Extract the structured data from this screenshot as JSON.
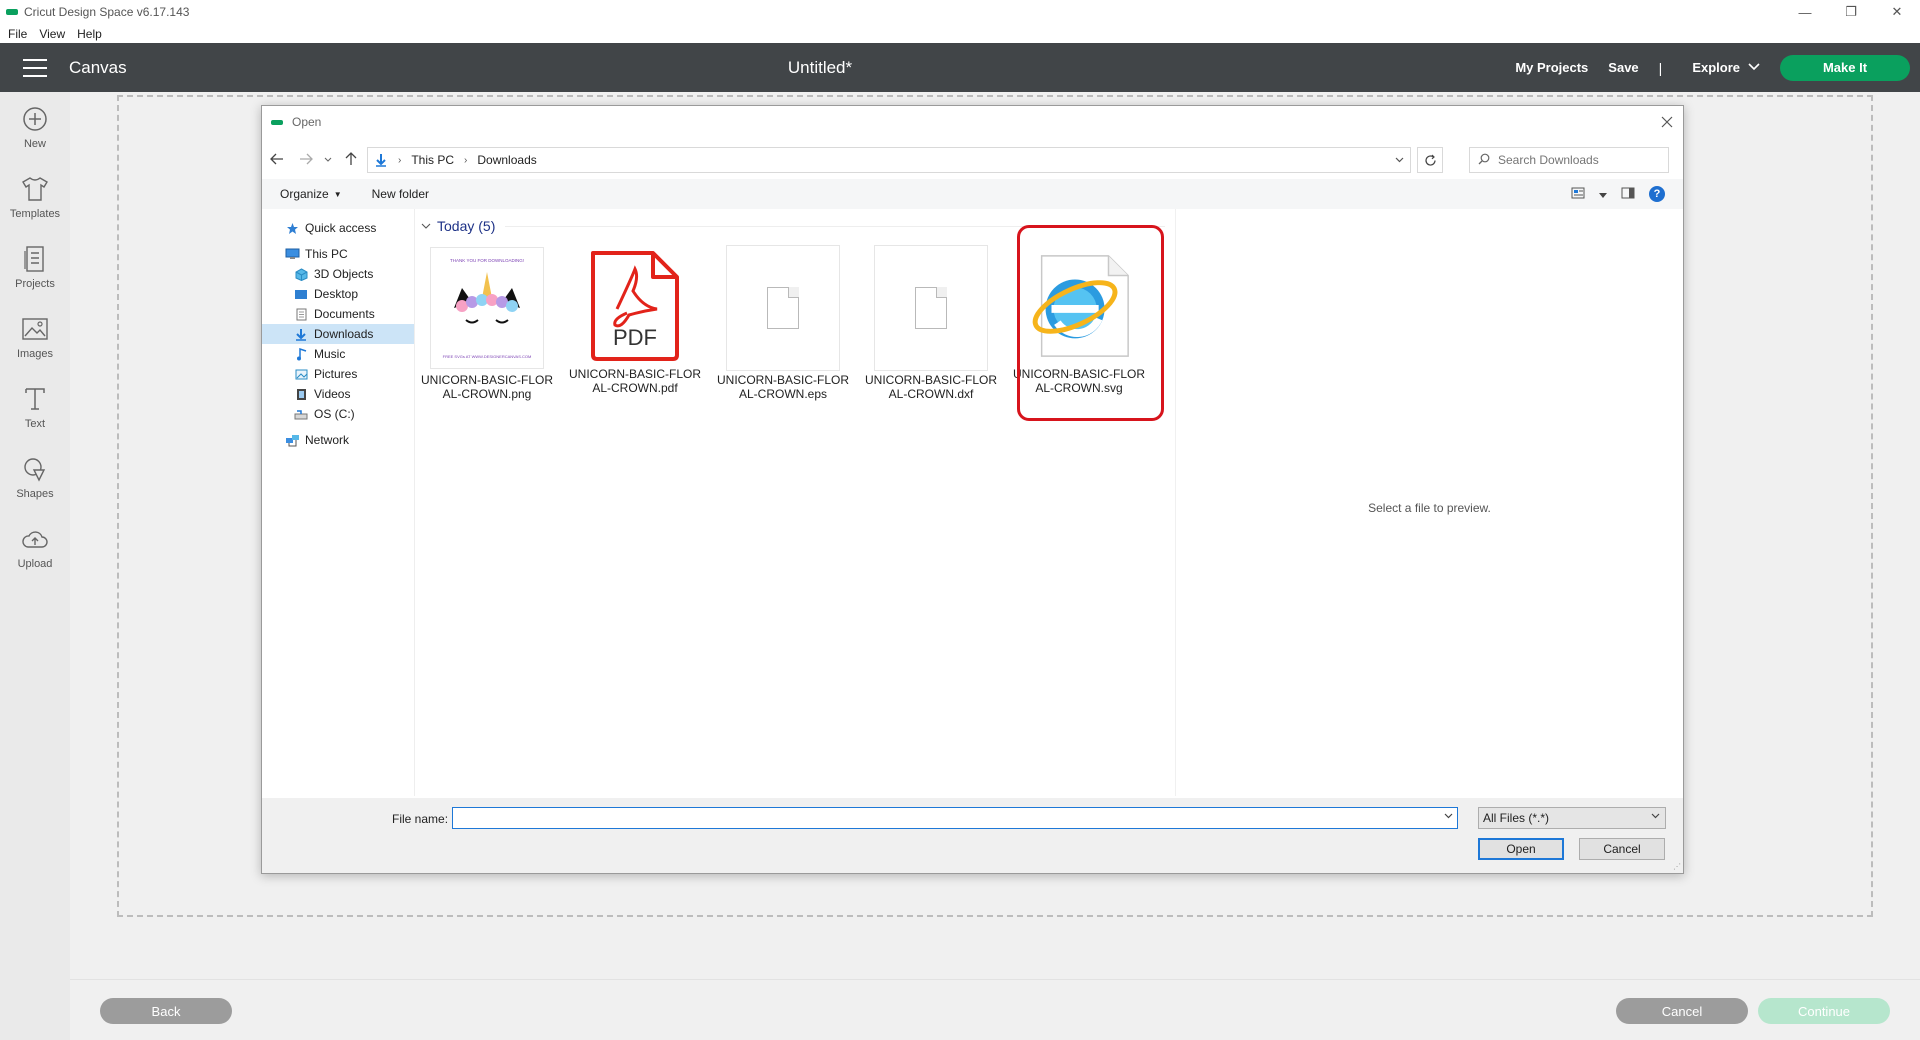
{
  "window": {
    "title": "Cricut Design Space  v6.17.143",
    "controls": [
      "—",
      "❐",
      "✕"
    ]
  },
  "menu": [
    "File",
    "View",
    "Help"
  ],
  "header": {
    "section": "Canvas",
    "doc_title": "Untitled*",
    "my_projects": "My Projects",
    "save": "Save",
    "separator": "|",
    "explore": "Explore",
    "make_it": "Make It",
    "accent": "#0aa05e"
  },
  "sidebar": {
    "items": [
      {
        "label": "New",
        "icon": "plus-circle-icon"
      },
      {
        "label": "Templates",
        "icon": "tshirt-icon"
      },
      {
        "label": "Projects",
        "icon": "projects-icon"
      },
      {
        "label": "Images",
        "icon": "image-icon"
      },
      {
        "label": "Text",
        "icon": "text-icon"
      },
      {
        "label": "Shapes",
        "icon": "shapes-icon"
      },
      {
        "label": "Upload",
        "icon": "upload-cloud-icon"
      }
    ]
  },
  "footer": {
    "back": "Back",
    "cancel": "Cancel",
    "continue": "Continue"
  },
  "dialog": {
    "title": "Open",
    "path": [
      "This PC",
      "Downloads"
    ],
    "search_placeholder": "Search Downloads",
    "organize": "Organize",
    "new_folder": "New folder",
    "nav": [
      {
        "label": "Quick access",
        "icon": "star-icon"
      },
      {
        "label": "This PC",
        "icon": "computer-icon"
      },
      {
        "label": "3D Objects",
        "icon": "cube-icon"
      },
      {
        "label": "Desktop",
        "icon": "desktop-icon"
      },
      {
        "label": "Documents",
        "icon": "document-icon"
      },
      {
        "label": "Downloads",
        "icon": "download-arrow-icon"
      },
      {
        "label": "Music",
        "icon": "music-note-icon"
      },
      {
        "label": "Pictures",
        "icon": "pictures-icon"
      },
      {
        "label": "Videos",
        "icon": "video-icon"
      },
      {
        "label": "OS (C:)",
        "icon": "drive-icon"
      },
      {
        "label": "Network",
        "icon": "network-icon"
      }
    ],
    "group": "Today (5)",
    "files": [
      {
        "name": "UNICORN-BASIC-FLORAL-CROWN.png",
        "type": "png"
      },
      {
        "name": "UNICORN-BASIC-FLORAL-CROWN.pdf",
        "type": "pdf"
      },
      {
        "name": "UNICORN-BASIC-FLORAL-CROWN.eps",
        "type": "eps"
      },
      {
        "name": "UNICORN-BASIC-FLORAL-CROWN.dxf",
        "type": "dxf"
      },
      {
        "name": "UNICORN-BASIC-FLORAL-CROWN.svg",
        "type": "svg"
      }
    ],
    "thumb_texts": {
      "png_top": "THANK YOU FOR DOWNLOADING!",
      "png_bottom": "FREE SVGs AT WWW.DESIGNERCANVAS.COM",
      "pdf": "PDF"
    },
    "preview_text": "Select a file to preview.",
    "file_name_label": "File name:",
    "file_name_value": "",
    "file_type": "All Files (*.*)",
    "open": "Open",
    "cancel": "Cancel",
    "highlight_color": "#d7141c"
  }
}
